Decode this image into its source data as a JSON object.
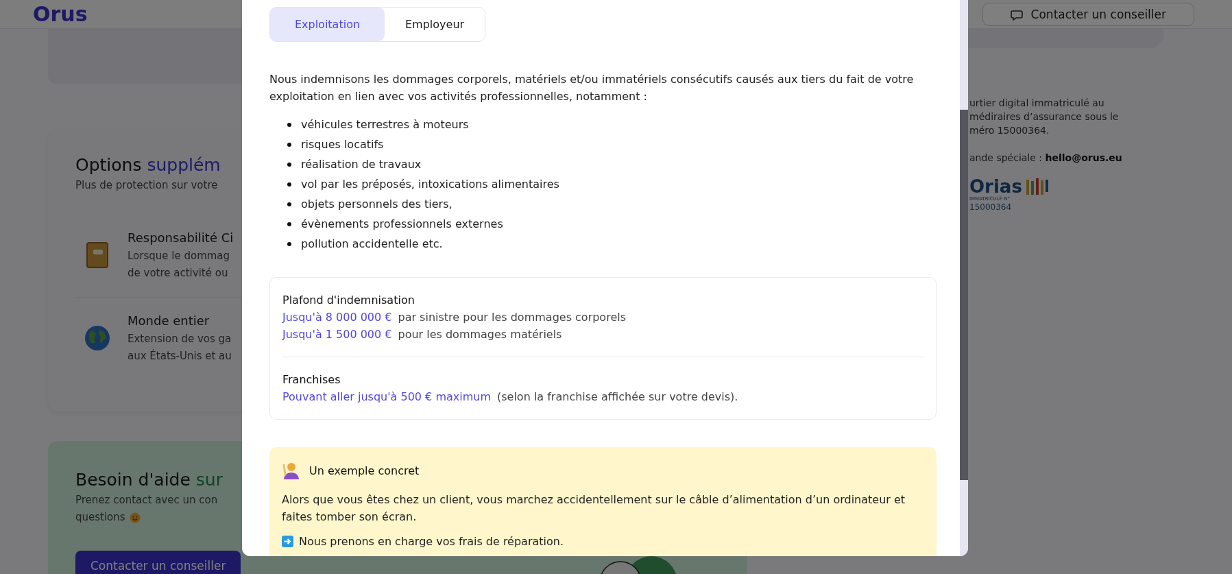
{
  "page": {
    "logo": "Orus",
    "header_button": "Contacter un conseiller",
    "options_card": {
      "title": "Options",
      "title_highlight": "supplém",
      "subtitle": "Plus de protection sur votre",
      "items": [
        {
          "kind": "book",
          "title": "Responsabilité Ci",
          "lines": [
            "Lorsque le dommag",
            "de votre activité ou"
          ]
        },
        {
          "kind": "globe",
          "title": "Monde entier",
          "lines": [
            "Extension de vos ga",
            "aux États-Unis et au"
          ]
        }
      ]
    },
    "help_card": {
      "title": "Besoin d'aide",
      "title_highlight": "sur",
      "lines": [
        "Prenez contact avec un con",
        "questions"
      ],
      "button": "Contacter un conseiller"
    },
    "legal": {
      "lines": [
        "urtier digital immatriculé au",
        "médiraires d’assurance sous le",
        "méro 15000364."
      ],
      "contact_label": "ande spéciale :",
      "contact_email": "hello@orus.eu"
    },
    "orias": {
      "name": "Orias",
      "caption": "IMMATRICULÉ N°",
      "number": "15000364"
    }
  },
  "modal": {
    "tabs": [
      {
        "label": "Exploitation",
        "selected": true
      },
      {
        "label": "Employeur",
        "selected": false
      }
    ],
    "intro": "Nous indemnisons les dommages corporels, matériels et/ou immatériels consécutifs causés aux tiers du fait de votre exploitation en lien avec vos activités professionnelles, notamment :",
    "bullets": [
      "véhicules terrestres à moteurs",
      "risques locatifs",
      "réalisation de travaux",
      "vol par les préposés, intoxications alimentaires",
      "objets personnels des tiers,",
      "évènements professionnels externes",
      "pollution accidentelle etc."
    ],
    "limits": [
      {
        "title": "Plafond d'indemnisation",
        "lines": [
          {
            "amount": "Jusqu'à 8 000 000 €",
            "text": "par sinistre pour les dommages corporels"
          },
          {
            "amount": "Jusqu'à 1 500 000 €",
            "text": "pour les dommages matériels"
          }
        ]
      },
      {
        "title": "Franchises",
        "lines": [
          {
            "amount": "Pouvant aller jusqu'à 500 € maximum",
            "text": "(selon la franchise affichée sur votre devis)."
          }
        ]
      }
    ],
    "example": {
      "title": "Un exemple concret",
      "text": "Alors que vous êtes chez un client, vous marchez accidentellement sur le câble d’alimentation d’un ordinateur et faites tomber son écran.",
      "outcome": "Nous prenons en charge vos frais de réparation."
    }
  }
}
